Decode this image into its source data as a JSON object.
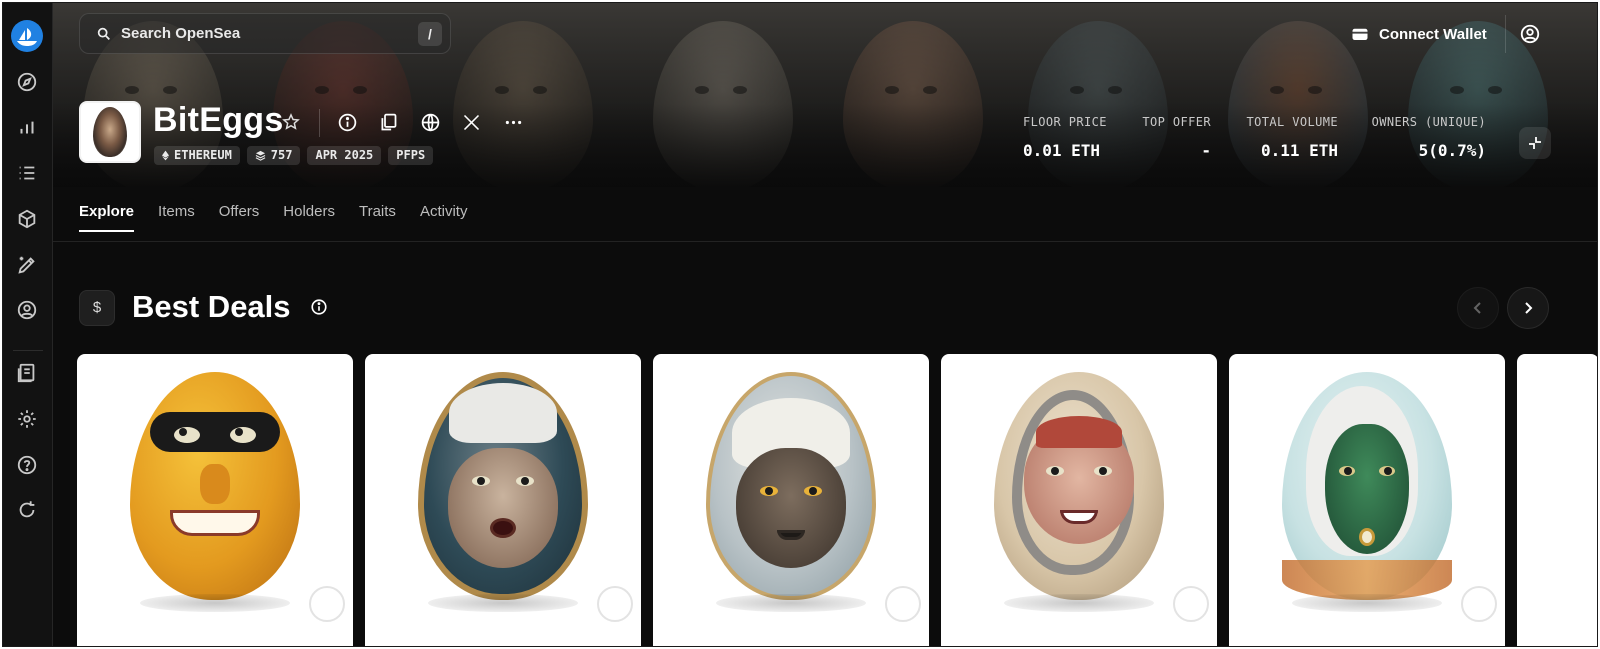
{
  "app": {
    "search_placeholder": "Search OpenSea",
    "search_shortcut": "/",
    "connect_wallet": "Connect Wallet"
  },
  "sidebar": {
    "items": [
      "opensea-logo-icon",
      "compass-icon",
      "bar-chart-icon",
      "list-icon",
      "cube-icon",
      "pen-icon",
      "profile-icon",
      "book-icon",
      "gear-icon",
      "help-icon",
      "refresh-icon"
    ]
  },
  "collection": {
    "name": "BitEggs",
    "chips": {
      "chain": "ETHEREUM",
      "items": "757",
      "date": "APR 2025",
      "category": "PFPS"
    },
    "stats": [
      {
        "label": "FLOOR PRICE",
        "value": "0.01 ETH"
      },
      {
        "label": "TOP OFFER",
        "value": "-"
      },
      {
        "label": "TOTAL VOLUME",
        "value": "0.11 ETH"
      },
      {
        "label": "OWNERS (UNIQUE)",
        "value": "5(0.7%)"
      }
    ]
  },
  "tabs": [
    "Explore",
    "Items",
    "Offers",
    "Holders",
    "Traits",
    "Activity"
  ],
  "section": {
    "icon_glyph": "$",
    "title": "Best Deals"
  },
  "colors": {
    "accent": "#2081e2",
    "background": "#0c0c0c",
    "sidebar": "#121212"
  }
}
